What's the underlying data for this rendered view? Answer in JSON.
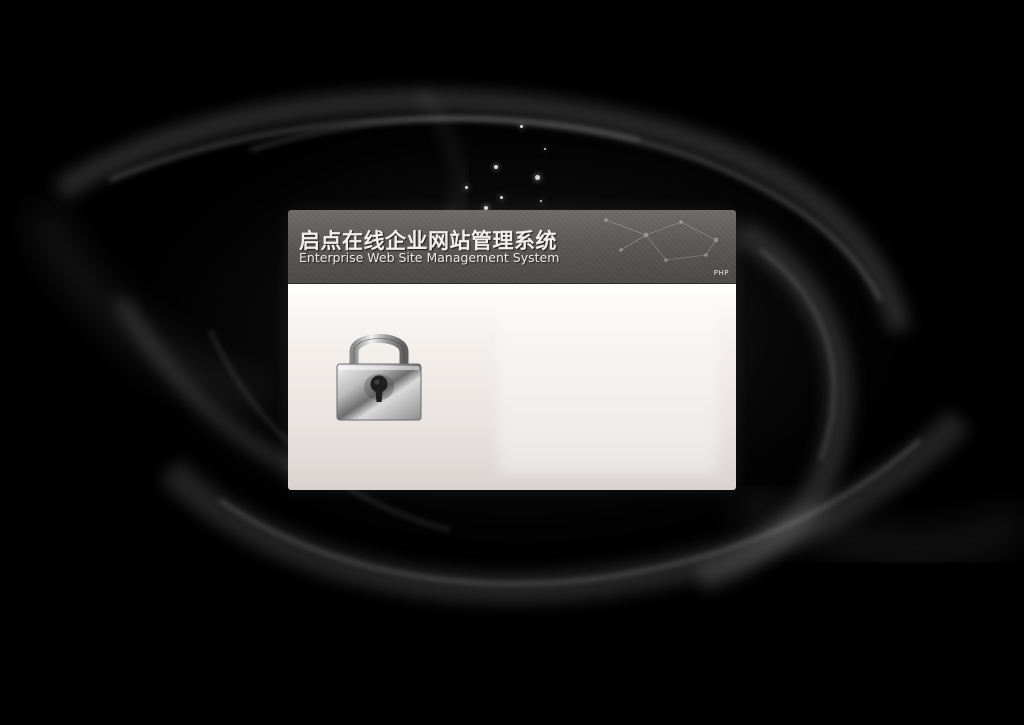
{
  "app": {
    "title_cn": "启点在线企业网站管理系统",
    "title_en": "Enterprise Web Site Management System",
    "edition_badge": "PHP"
  },
  "login_panel": {
    "lock_icon": "padlock-icon"
  },
  "colors": {
    "background": "#000000",
    "header_top": "#6e6c6a",
    "header_bottom": "#4a4947",
    "body_top": "#ffffff",
    "body_bottom": "#d8d3d0",
    "title_text": "#f1f0ec"
  }
}
